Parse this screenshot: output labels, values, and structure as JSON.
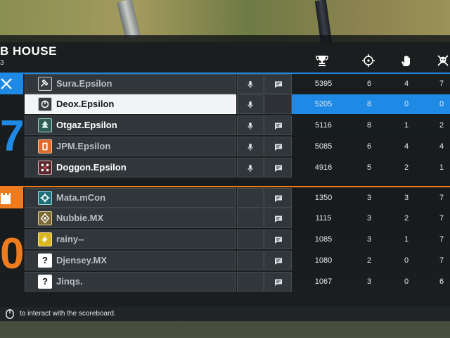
{
  "header": {
    "title": "B HOUSE",
    "subtitle": "3"
  },
  "columns": [
    {
      "name": "score",
      "icon": "trophy-icon"
    },
    {
      "name": "kills",
      "icon": "crosshair-icon"
    },
    {
      "name": "assists",
      "icon": "hand-icon"
    },
    {
      "name": "deaths",
      "icon": "skull-icon"
    }
  ],
  "teams": {
    "blue": {
      "score": "7",
      "color": "#1f8ae6",
      "players": [
        {
          "name": "Sura.Epsilon",
          "op_icon": "hammer-operator-icon",
          "mic": true,
          "chat": true,
          "score": "5395",
          "kills": "6",
          "assists": "4",
          "deaths": "7",
          "dim": true
        },
        {
          "name": "Deox.Epsilon",
          "op_icon": "power-operator-icon",
          "mic": true,
          "chat": false,
          "score": "5205",
          "kills": "8",
          "assists": "0",
          "deaths": "0",
          "dim": false,
          "selected": true
        },
        {
          "name": "Otgaz.Epsilon",
          "op_icon": "tree-operator-icon",
          "mic": true,
          "chat": true,
          "score": "5116",
          "kills": "8",
          "assists": "1",
          "deaths": "2",
          "dim": false
        },
        {
          "name": "JPM.Epsilon",
          "op_icon": "shield-operator-icon",
          "mic": true,
          "chat": true,
          "score": "5085",
          "kills": "6",
          "assists": "4",
          "deaths": "4",
          "dim": true
        },
        {
          "name": "Doggon.Epsilon",
          "op_icon": "drone-operator-icon",
          "mic": true,
          "chat": true,
          "score": "4916",
          "kills": "5",
          "assists": "2",
          "deaths": "1",
          "dim": false
        }
      ]
    },
    "orange": {
      "score": "0",
      "color": "#ef7b1f",
      "players": [
        {
          "name": "Mata.mCon",
          "op_icon": "gear-operator-icon",
          "mic": false,
          "chat": true,
          "score": "1350",
          "kills": "3",
          "assists": "3",
          "deaths": "7",
          "dim": true
        },
        {
          "name": "Nubbie.MX",
          "op_icon": "rune-operator-icon",
          "mic": false,
          "chat": true,
          "score": "1115",
          "kills": "3",
          "assists": "2",
          "deaths": "7",
          "dim": true
        },
        {
          "name": "rainy--",
          "op_icon": "bolt-operator-icon",
          "mic": false,
          "chat": true,
          "score": "1085",
          "kills": "3",
          "assists": "1",
          "deaths": "7",
          "dim": true
        },
        {
          "name": "Djensey.MX",
          "op_icon": "unknown-operator-icon",
          "mic": false,
          "chat": true,
          "score": "1080",
          "kills": "2",
          "assists": "0",
          "deaths": "7",
          "dim": true
        },
        {
          "name": "Jinqs.",
          "op_icon": "unknown-operator-icon",
          "mic": false,
          "chat": true,
          "score": "1067",
          "kills": "3",
          "assists": "0",
          "deaths": "6",
          "dim": true
        }
      ]
    }
  },
  "unknown_glyph": "?",
  "footer": {
    "hint": "to interact with the scoreboard."
  }
}
